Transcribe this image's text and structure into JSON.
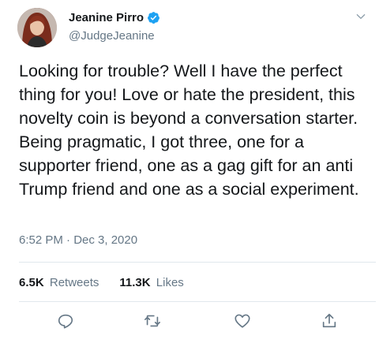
{
  "author": {
    "display_name": "Jeanine Pirro",
    "handle": "@JudgeJeanine",
    "verified": true,
    "avatar_icon": "profile-photo"
  },
  "tweet": {
    "text": "Looking for trouble? Well I have the perfect thing for you! Love or hate the president, this novelty coin is beyond a conversation starter. Being pragmatic, I got three, one for a supporter friend, one as a gag gift for an anti Trump friend and one as a social experiment.",
    "timestamp": "6:52 PM · Dec 3, 2020"
  },
  "stats": {
    "retweets_count": "6.5K",
    "retweets_label": "Retweets",
    "likes_count": "11.3K",
    "likes_label": "Likes"
  },
  "actions": [
    {
      "icon": "reply-icon"
    },
    {
      "icon": "retweet-icon"
    },
    {
      "icon": "like-icon"
    },
    {
      "icon": "share-icon"
    }
  ],
  "colors": {
    "accent": "#1da1f2",
    "text": "#14171a",
    "secondary": "#657786",
    "divider": "#e1e8ed"
  }
}
